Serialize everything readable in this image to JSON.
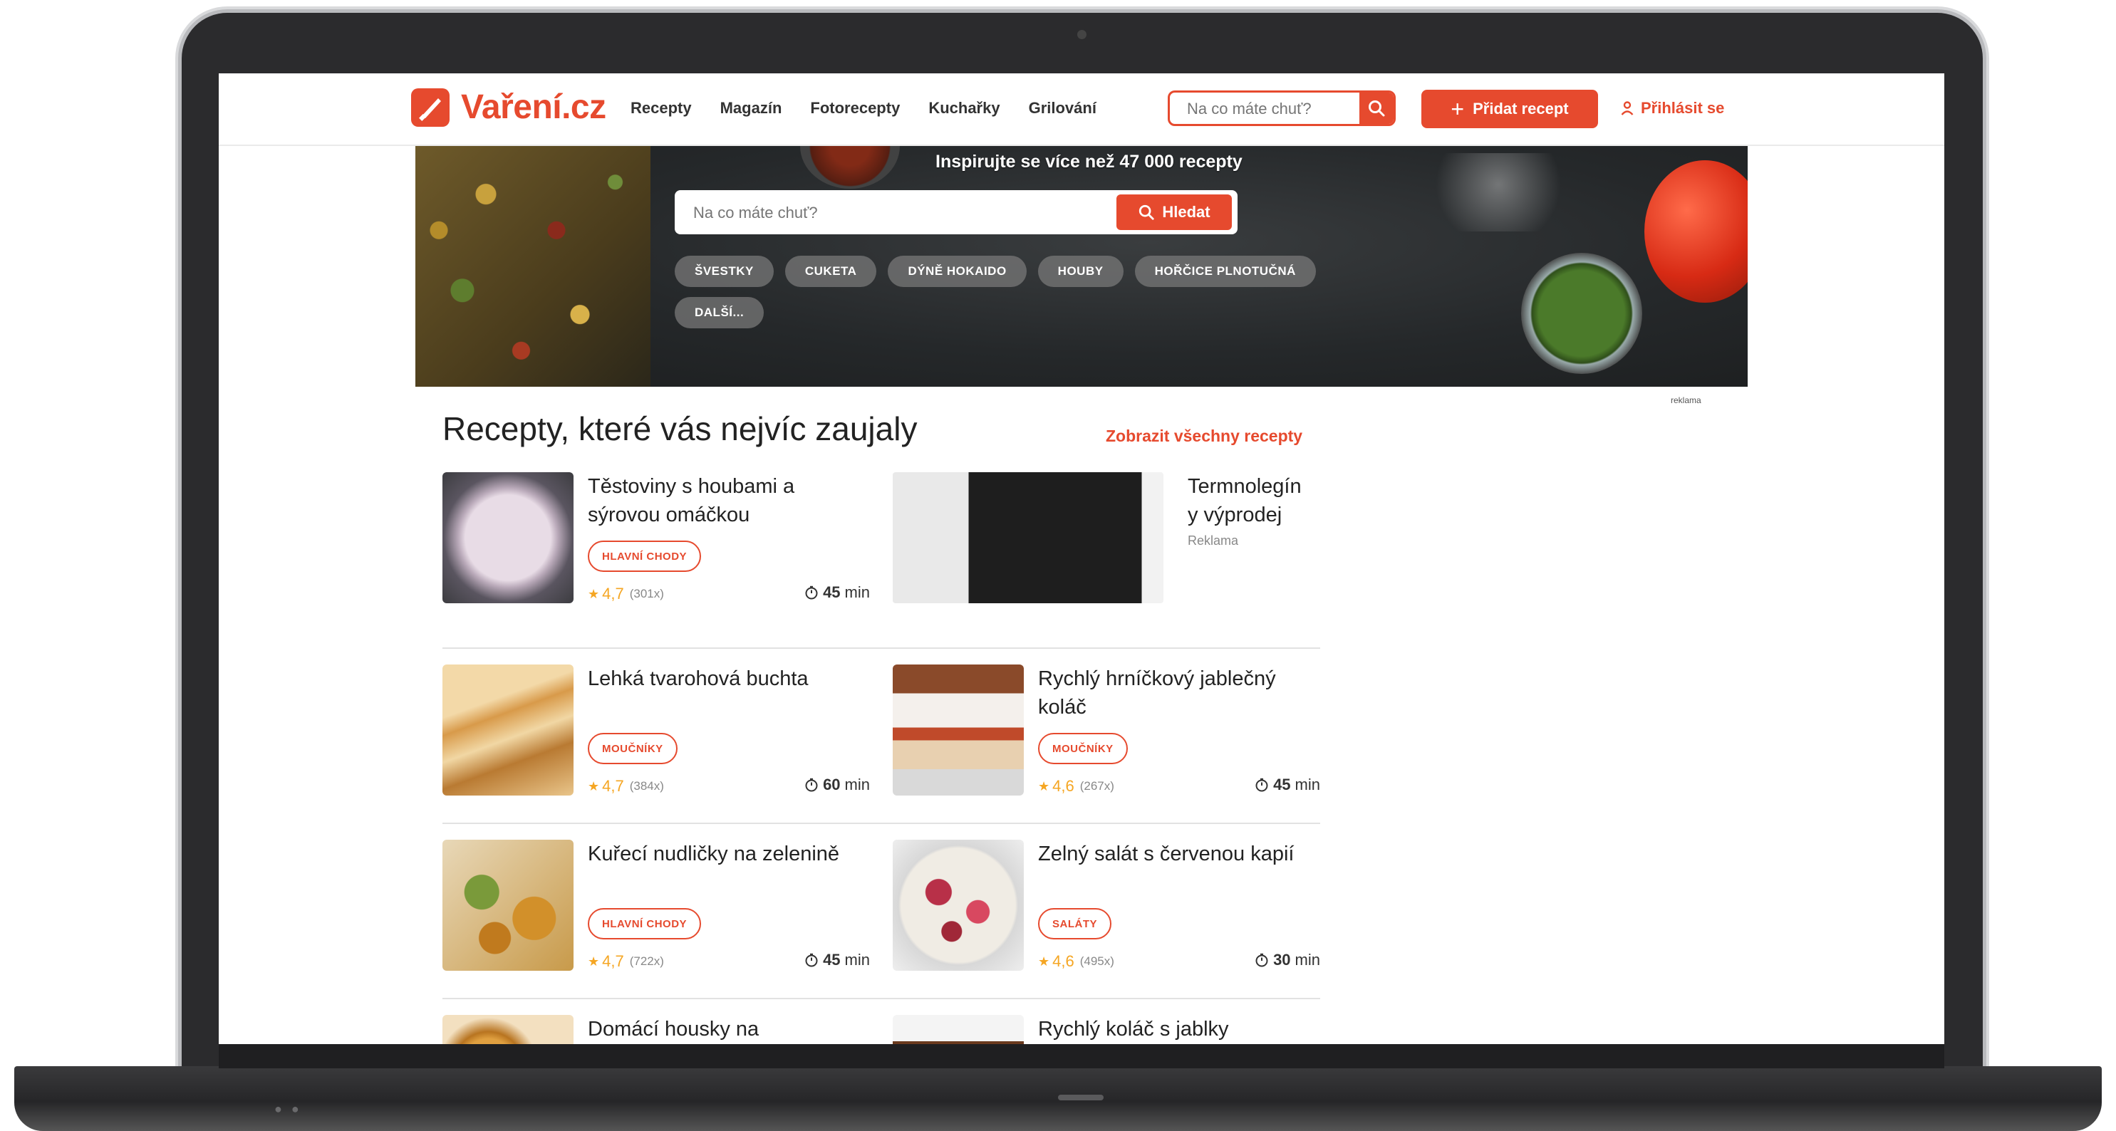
{
  "header": {
    "logo": "Vaření.cz",
    "nav": [
      "Recepty",
      "Magazín",
      "Fotorecepty",
      "Kuchařky",
      "Grilování"
    ],
    "search_placeholder": "Na co máte chuť?",
    "add_label": "Přidat recept",
    "login_label": "Přihlásit se"
  },
  "hero": {
    "title": "Inspirujte se více než 47 000 recepty",
    "search_placeholder": "Na co máte chuť?",
    "search_button": "Hledat",
    "tags": [
      "ŠVESTKY",
      "CUKETA",
      "DÝNĚ HOKAIDO",
      "HOUBY",
      "HOŘČICE PLNOTUČNÁ",
      "DALŠÍ..."
    ],
    "ad_label": "reklama"
  },
  "recipes": {
    "title": "Recepty, které vás nejvíc zaujaly",
    "see_all": "Zobrazit všechny recepty",
    "items": [
      {
        "title": "Těstoviny s houbami a sýrovou omáčkou",
        "category": "HLAVNÍ CHODY",
        "rating": "4,7",
        "count": "(301x)",
        "time": "45",
        "time_unit": "min"
      },
      {
        "title": "Lehká tvarohová buchta",
        "category": "MOUČNÍKY",
        "rating": "4,7",
        "count": "(384x)",
        "time": "60",
        "time_unit": "min"
      },
      {
        "title": "Rychlý hrníčkový jablečný koláč",
        "category": "MOUČNÍKY",
        "rating": "4,6",
        "count": "(267x)",
        "time": "45",
        "time_unit": "min"
      },
      {
        "title": "Kuřecí nudličky na zelenině",
        "category": "HLAVNÍ CHODY",
        "rating": "4,7",
        "count": "(722x)",
        "time": "45",
        "time_unit": "min"
      },
      {
        "title": "Zelný salát s červenou kapií",
        "category": "SALÁTY",
        "rating": "4,6",
        "count": "(495x)",
        "time": "30",
        "time_unit": "min"
      },
      {
        "title": "Domácí housky na hamburgery"
      },
      {
        "title": "Rychlý koláč s jablky"
      }
    ],
    "ad": {
      "title": "Termnolegín y výprodej",
      "label": "Reklama"
    }
  },
  "colors": {
    "brand": "#e64a2e",
    "star": "#f5a623"
  },
  "icons": [
    "knife-logo-icon",
    "search-icon",
    "plus-icon",
    "user-icon",
    "star-icon",
    "clock-icon"
  ]
}
